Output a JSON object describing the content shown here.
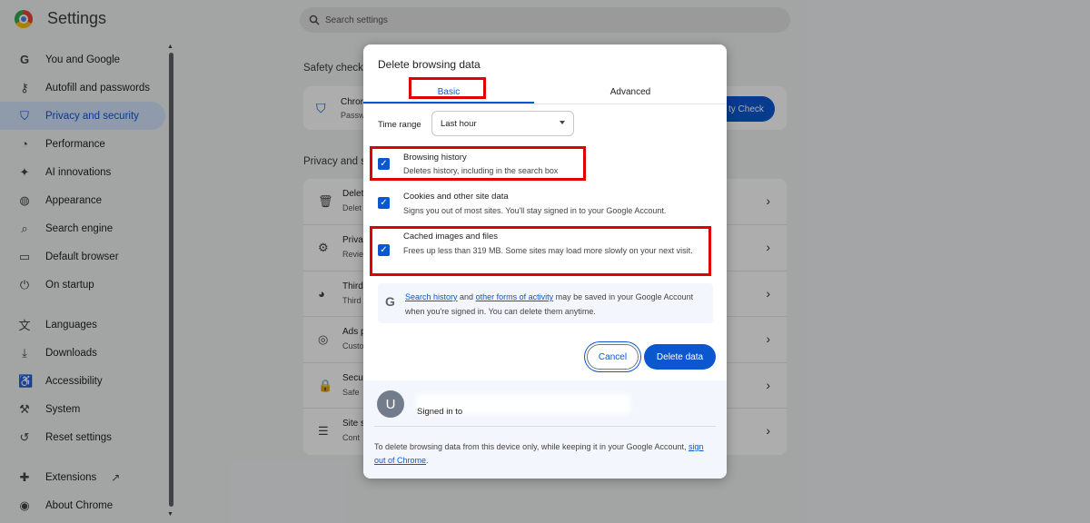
{
  "app": {
    "title": "Settings"
  },
  "search": {
    "placeholder": "Search settings"
  },
  "sidebar": {
    "items": [
      {
        "label": "You and Google",
        "icon": "google-icon"
      },
      {
        "label": "Autofill and passwords",
        "icon": "key-icon"
      },
      {
        "label": "Privacy and security",
        "icon": "shield-icon",
        "active": true
      },
      {
        "label": "Performance",
        "icon": "speedometer-icon"
      },
      {
        "label": "AI innovations",
        "icon": "sparkle-icon"
      },
      {
        "label": "Appearance",
        "icon": "palette-icon"
      },
      {
        "label": "Search engine",
        "icon": "search-icon"
      },
      {
        "label": "Default browser",
        "icon": "browser-icon"
      },
      {
        "label": "On startup",
        "icon": "power-icon"
      },
      {
        "label": "Languages",
        "icon": "translate-icon"
      },
      {
        "label": "Downloads",
        "icon": "download-icon"
      },
      {
        "label": "Accessibility",
        "icon": "accessibility-icon"
      },
      {
        "label": "System",
        "icon": "wrench-icon"
      },
      {
        "label": "Reset settings",
        "icon": "reset-icon"
      },
      {
        "label": "Extensions",
        "icon": "puzzle-icon"
      },
      {
        "label": "About Chrome",
        "icon": "chrome-icon"
      }
    ]
  },
  "background": {
    "safety_check_label": "Safety check",
    "safety_row_title": "Chror",
    "safety_row_sub": "Passw",
    "safety_button": "ty Check",
    "privacy_label": "Privacy and s",
    "rows": [
      {
        "t1": "Delet",
        "t2": "Delet",
        "icon": "trash-icon"
      },
      {
        "t1": "Priva",
        "t2": "Revie",
        "icon": "tune-icon"
      },
      {
        "t1": "Third",
        "t2": "Third",
        "icon": "cookie-icon"
      },
      {
        "t1": "Ads p",
        "t2": "Custo",
        "icon": "ads-icon"
      },
      {
        "t1": "Secu",
        "t2": "Safe",
        "icon": "lock-icon"
      },
      {
        "t1": "Site s",
        "t2": "Cont",
        "icon": "sliders-icon"
      }
    ]
  },
  "dialog": {
    "title": "Delete browsing data",
    "tabs": {
      "basic": "Basic",
      "advanced": "Advanced"
    },
    "time_range_label": "Time range",
    "time_range_value": "Last hour",
    "options": [
      {
        "title": "Browsing history",
        "desc": "Deletes history, including in the search box",
        "checked": true
      },
      {
        "title": "Cookies and other site data",
        "desc": "Signs you out of most sites. You'll stay signed in to your Google Account.",
        "checked": true
      },
      {
        "title": "Cached images and files",
        "desc": "Frees up less than 319 MB. Some sites may load more slowly on your next visit.",
        "checked": true
      }
    ],
    "notice": {
      "link1": "Search history",
      "and": " and ",
      "link2": "other forms of activity",
      "rest": " may be saved in your Google Account when you're signed in. You can delete them anytime."
    },
    "cancel": "Cancel",
    "delete": "Delete data",
    "account": {
      "avatar_letter": "U",
      "signed_in": "Signed in to"
    },
    "footer": {
      "text": "To delete browsing data from this device only, while keeping it in your Google Account, ",
      "link": "sign out of Chrome",
      "end": "."
    }
  },
  "colors": {
    "accent": "#0b57d0",
    "highlight": "#e00000",
    "active_nav_bg": "#d3e3fd"
  }
}
